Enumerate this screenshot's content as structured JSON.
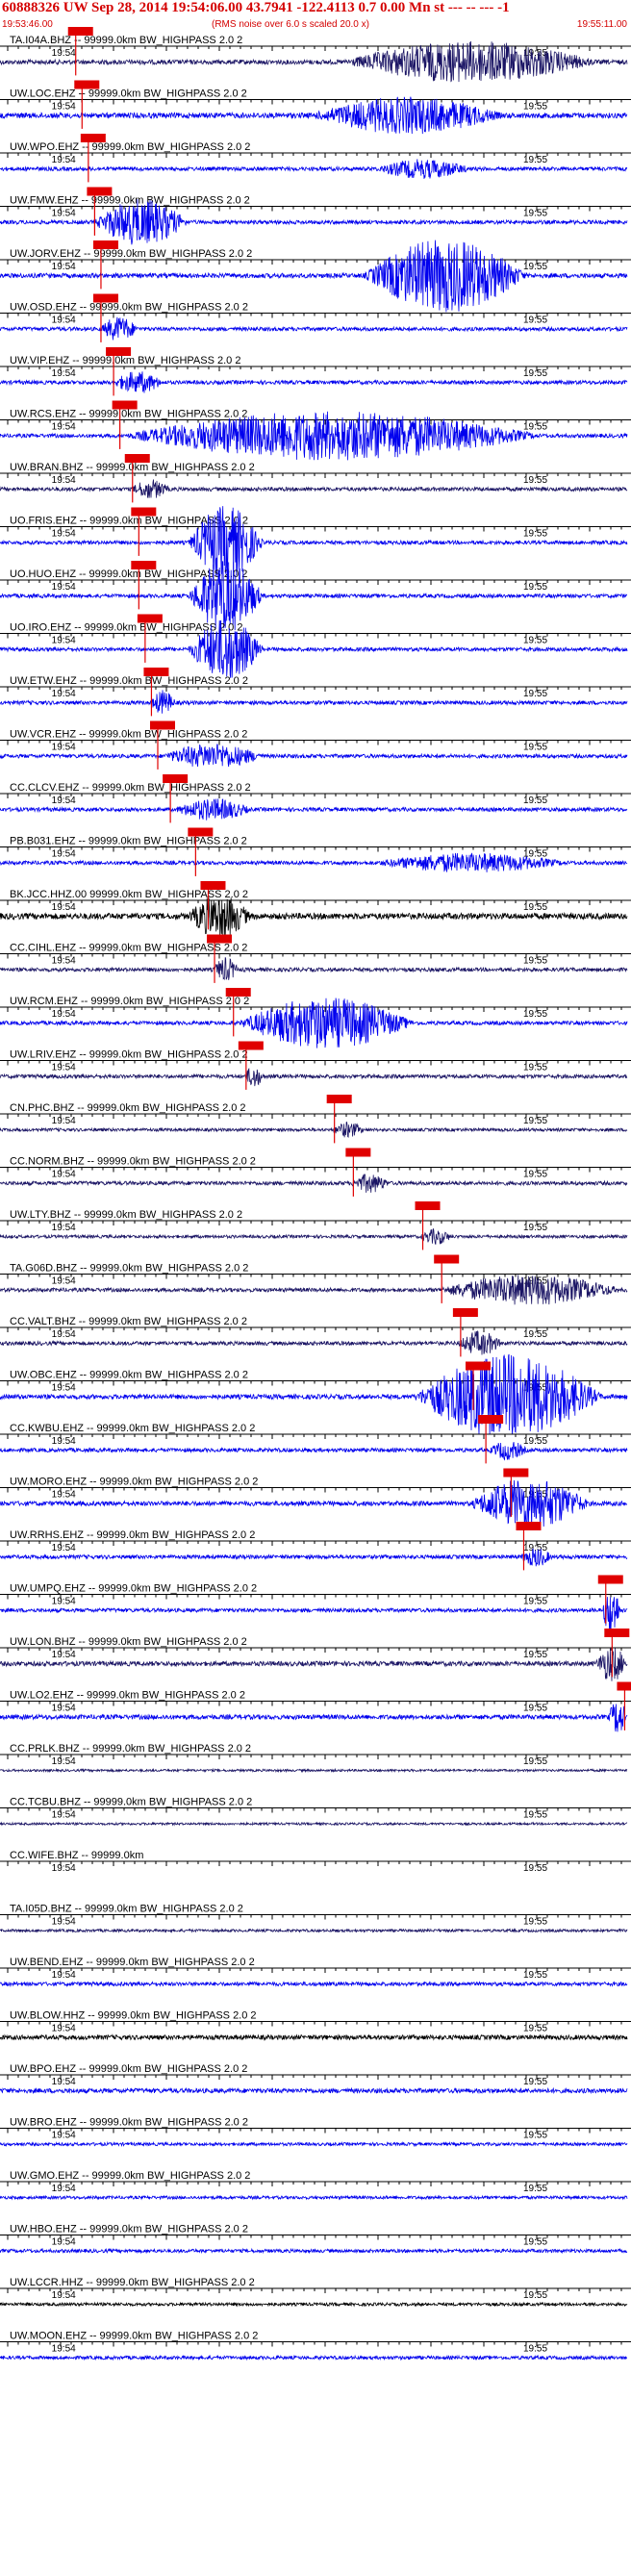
{
  "header": {
    "title": "60888326 UW Sep 28, 2014 19:54:06.00   43.7941 -122.4113  0.7 0.00 Mn st --- -- ---  -1",
    "start_time": "19:53:46.00",
    "rms_note": "(RMS noise over 6.0 s scaled 20.0 x)",
    "end_time": "19:55:11.00"
  },
  "chart_data": {
    "type": "seismogram-record-section",
    "colors": {
      "blue": "#0000ee",
      "navy": "#1a1464",
      "black": "#000000",
      "pick": "#e00000"
    },
    "time_ticks": [
      "19:54",
      "19:55"
    ],
    "traces": [
      {
        "label": "TA.I04A.BHZ -- 99999.0km BW_HIGHPASS  2.0  2",
        "color": "navy",
        "amp": 0.6,
        "pick": 0.12,
        "burst": [
          0.55,
          0.95,
          1.4
        ]
      },
      {
        "label": "UW.LOC.EHZ -- 99999.0km BW_HIGHPASS  2.0  2",
        "color": "blue",
        "amp": 0.7,
        "pick": 0.13,
        "burst": [
          0.5,
          0.8,
          1.2
        ]
      },
      {
        "label": "UW.WPO.EHZ -- 99999.0km BW_HIGHPASS  2.0  2",
        "color": "blue",
        "amp": 0.5,
        "pick": 0.14,
        "burst": [
          0.6,
          0.75,
          0.6
        ]
      },
      {
        "label": "UW.FMW.EHZ -- 99999.0km BW_HIGHPASS  2.0  2",
        "color": "blue",
        "amp": 0.5,
        "pick": 0.15,
        "burst": [
          0.15,
          0.3,
          1.6
        ]
      },
      {
        "label": "UW.JORV.EHZ -- 99999.0km BW_HIGHPASS  2.0  2",
        "color": "blue",
        "amp": 0.6,
        "pick": 0.16,
        "burst": [
          0.58,
          0.84,
          2.6
        ]
      },
      {
        "label": "UW.OSD.EHZ -- 99999.0km BW_HIGHPASS  2.0  2",
        "color": "blue",
        "amp": 0.5,
        "pick": 0.16,
        "burst": [
          0.16,
          0.22,
          0.8
        ]
      },
      {
        "label": "UW.VIP.EHZ -- 99999.0km BW_HIGHPASS  2.0  2",
        "color": "blue",
        "amp": 0.5,
        "pick": 0.18,
        "burst": [
          0.18,
          0.26,
          0.7
        ]
      },
      {
        "label": "UW.RCS.EHZ -- 99999.0km BW_HIGHPASS  2.0  2",
        "color": "blue",
        "amp": 0.5,
        "pick": 0.19,
        "burst": [
          0.2,
          0.86,
          1.7
        ]
      },
      {
        "label": "UW.BRAN.BHZ -- 99999.0km BW_HIGHPASS  2.0  2",
        "color": "navy",
        "amp": 0.5,
        "pick": 0.21,
        "burst": [
          0.21,
          0.27,
          0.6
        ]
      },
      {
        "label": "UO.FRIS.EHZ -- 99999.0km BW_HIGHPASS  2.0  2",
        "color": "blue",
        "amp": 0.5,
        "pick": 0.22,
        "burst": [
          0.3,
          0.42,
          2.6
        ]
      },
      {
        "label": "UO.HUO.EHZ -- 99999.0km BW_HIGHPASS  2.0  2",
        "color": "blue",
        "amp": 0.5,
        "pick": 0.22,
        "burst": [
          0.3,
          0.42,
          2.6
        ]
      },
      {
        "label": "UO.IRO.EHZ -- 99999.0km BW_HIGHPASS  2.0  2",
        "color": "blue",
        "amp": 0.5,
        "pick": 0.23,
        "burst": [
          0.3,
          0.42,
          2.2
        ]
      },
      {
        "label": "UW.ETW.EHZ -- 99999.0km BW_HIGHPASS  2.0  2",
        "color": "blue",
        "amp": 0.5,
        "pick": 0.24,
        "burst": [
          0.24,
          0.28,
          0.8
        ]
      },
      {
        "label": "UW.VCR.EHZ -- 99999.0km BW_HIGHPASS  2.0  2",
        "color": "blue",
        "amp": 0.5,
        "pick": 0.25,
        "burst": [
          0.26,
          0.42,
          0.8
        ]
      },
      {
        "label": "CC.CLCV.EHZ -- 99999.0km BW_HIGHPASS  2.0  2",
        "color": "blue",
        "amp": 0.5,
        "pick": 0.27,
        "burst": [
          0.28,
          0.4,
          0.7
        ]
      },
      {
        "label": "PB.B031.EHZ -- 99999.0km BW_HIGHPASS  2.0  2",
        "color": "blue",
        "amp": 0.5,
        "pick": 0.31,
        "burst": [
          0.6,
          0.9,
          0.6
        ]
      },
      {
        "label": "BK.JCC.HHZ.00 99999.0km BW_HIGHPASS  2.0  2",
        "color": "black",
        "amp": 0.8,
        "pick": 0.33,
        "burst": [
          0.3,
          0.4,
          1.4
        ]
      },
      {
        "label": "CC.CIHL.EHZ -- 99999.0km BW_HIGHPASS  2.0  2",
        "color": "navy",
        "amp": 0.5,
        "pick": 0.34,
        "burst": [
          0.34,
          0.38,
          0.8
        ]
      },
      {
        "label": "UW.RCM.EHZ -- 99999.0km BW_HIGHPASS  2.0  2",
        "color": "blue",
        "amp": 0.5,
        "pick": 0.37,
        "burst": [
          0.38,
          0.66,
          1.8
        ]
      },
      {
        "label": "UW.LRIV.EHZ -- 99999.0km BW_HIGHPASS  2.0  2",
        "color": "navy",
        "amp": 0.5,
        "pick": 0.39,
        "burst": [
          0.39,
          0.42,
          0.7
        ]
      },
      {
        "label": "CN.PHC.BHZ -- 99999.0km BW_HIGHPASS  2.0  2",
        "color": "navy",
        "amp": 0.4,
        "pick": 0.53,
        "burst": [
          0.53,
          0.58,
          0.5
        ]
      },
      {
        "label": "CC.NORM.BHZ -- 99999.0km BW_HIGHPASS  2.0  2",
        "color": "navy",
        "amp": 0.5,
        "pick": 0.56,
        "burst": [
          0.56,
          0.62,
          0.6
        ]
      },
      {
        "label": "UW.LTY.BHZ -- 99999.0km BW_HIGHPASS  2.0  2",
        "color": "navy",
        "amp": 0.4,
        "pick": 0.67,
        "burst": [
          0.67,
          0.72,
          0.5
        ]
      },
      {
        "label": "TA.G06D.BHZ -- 99999.0km BW_HIGHPASS  2.0  2",
        "color": "navy",
        "amp": 0.5,
        "pick": 0.7,
        "burst": [
          0.7,
          0.99,
          1.0
        ]
      },
      {
        "label": "CC.VALT.BHZ -- 99999.0km BW_HIGHPASS  2.0  2",
        "color": "navy",
        "amp": 0.5,
        "pick": 0.73,
        "burst": [
          0.73,
          0.8,
          0.8
        ]
      },
      {
        "label": "UW.OBC.EHZ -- 99999.0km BW_HIGHPASS  2.0  2",
        "color": "blue",
        "amp": 0.6,
        "pick": 0.75,
        "burst": [
          0.66,
          0.96,
          3.0
        ]
      },
      {
        "label": "CC.KWBU.EHZ -- 99999.0km BW_HIGHPASS  2.0  2",
        "color": "blue",
        "amp": 0.5,
        "pick": 0.77,
        "burst": [
          0.78,
          0.84,
          0.6
        ]
      },
      {
        "label": "UW.MORO.EHZ -- 99999.0km BW_HIGHPASS  2.0  2",
        "color": "blue",
        "amp": 0.6,
        "pick": 0.81,
        "burst": [
          0.75,
          0.94,
          1.8
        ]
      },
      {
        "label": "UW.RRHS.EHZ -- 99999.0km BW_HIGHPASS  2.0  2",
        "color": "blue",
        "amp": 0.5,
        "pick": 0.83,
        "burst": [
          0.83,
          0.88,
          0.6
        ]
      },
      {
        "label": "UW.UMPQ.EHZ -- 99999.0km BW_HIGHPASS  2.0  2",
        "color": "blue",
        "amp": 0.5,
        "pick": 0.96,
        "burst": [
          0.96,
          0.99,
          1.8
        ]
      },
      {
        "label": "UW.LON.BHZ -- 99999.0km BW_HIGHPASS  2.0  2",
        "color": "navy",
        "amp": 0.6,
        "pick": 0.97,
        "burst": [
          0.95,
          1.0,
          1.2
        ]
      },
      {
        "label": "UW.LO2.EHZ -- 99999.0km BW_HIGHPASS  2.0  2",
        "color": "blue",
        "amp": 0.6,
        "pick": 0.99,
        "burst": [
          0.97,
          1.0,
          1.2
        ]
      },
      {
        "label": "CC.PRLK.BHZ -- 99999.0km BW_HIGHPASS  2.0  2",
        "color": "navy",
        "amp": 0.3,
        "pick": null,
        "burst": null
      },
      {
        "label": "CC.TCBU.BHZ -- 99999.0km BW_HIGHPASS  2.0  2",
        "color": "navy",
        "amp": 0.3,
        "pick": null,
        "burst": null
      },
      {
        "label": "CC.WIFE.BHZ -- 99999.0km",
        "color": "navy",
        "amp": 0.0,
        "pick": null,
        "burst": null
      },
      {
        "label": "TA.I05D.BHZ -- 99999.0km BW_HIGHPASS  2.0  2",
        "color": "navy",
        "amp": 0.35,
        "pick": null,
        "burst": null
      },
      {
        "label": "UW.BEND.EHZ -- 99999.0km BW_HIGHPASS  2.0  2",
        "color": "blue",
        "amp": 0.5,
        "pick": null,
        "burst": null
      },
      {
        "label": "UW.BLOW.HHZ -- 99999.0km BW_HIGHPASS  2.0  2",
        "color": "black",
        "amp": 0.6,
        "pick": null,
        "burst": null
      },
      {
        "label": "UW.BPO.EHZ -- 99999.0km BW_HIGHPASS  2.0  2",
        "color": "blue",
        "amp": 0.6,
        "pick": null,
        "burst": null
      },
      {
        "label": "UW.BRO.EHZ -- 99999.0km BW_HIGHPASS  2.0  2",
        "color": "blue",
        "amp": 0.4,
        "pick": null,
        "burst": null
      },
      {
        "label": "UW.GMO.EHZ -- 99999.0km BW_HIGHPASS  2.0  2",
        "color": "blue",
        "amp": 0.4,
        "pick": null,
        "burst": null
      },
      {
        "label": "UW.HBO.EHZ -- 99999.0km BW_HIGHPASS  2.0  2",
        "color": "blue",
        "amp": 0.45,
        "pick": null,
        "burst": null
      },
      {
        "label": "UW.LCCR.HHZ -- 99999.0km BW_HIGHPASS  2.0  2",
        "color": "black",
        "amp": 0.4,
        "pick": null,
        "burst": null
      },
      {
        "label": "UW.MOON.EHZ -- 99999.0km BW_HIGHPASS  2.0  2",
        "color": "blue",
        "amp": 0.45,
        "pick": null,
        "burst": null
      }
    ]
  }
}
